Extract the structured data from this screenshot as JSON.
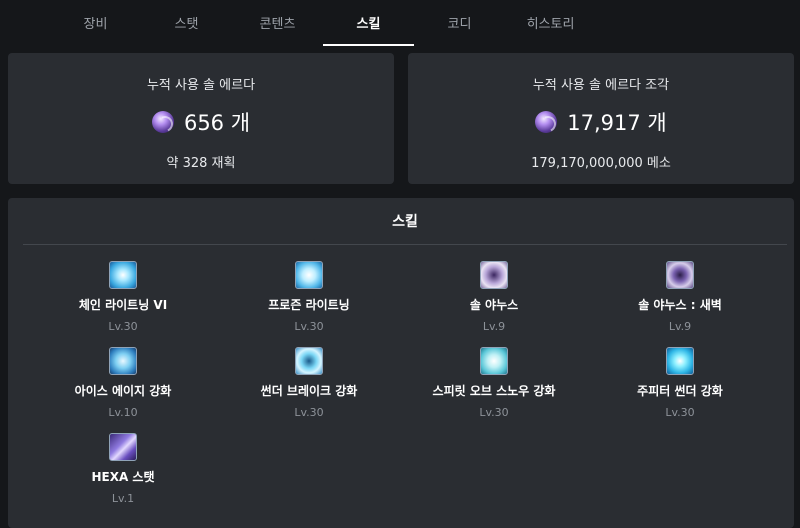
{
  "tabs": [
    {
      "label": "장비",
      "active": false
    },
    {
      "label": "스탯",
      "active": false
    },
    {
      "label": "콘텐츠",
      "active": false
    },
    {
      "label": "스킬",
      "active": true
    },
    {
      "label": "코디",
      "active": false
    },
    {
      "label": "히스토리",
      "active": false
    }
  ],
  "sol_erda": {
    "title": "누적 사용 솔 에르다",
    "value": "656 개",
    "sub": "약 328 재획",
    "icon": "sol-erda-orb-icon"
  },
  "sol_erda_fragment": {
    "title": "누적 사용 솔 에르다 조각",
    "value": "17,917 개",
    "sub": "179,170,000,000 메소",
    "icon": "sol-erda-orb-icon"
  },
  "skills": {
    "title": "스킬",
    "items": [
      {
        "name": "체인 라이트닝 VI",
        "level": "Lv.30",
        "icon": "chain-lightning-icon"
      },
      {
        "name": "프로즌 라이트닝",
        "level": "Lv.30",
        "icon": "frozen-lightning-icon"
      },
      {
        "name": "솔 야누스",
        "level": "Lv.9",
        "icon": "sol-janus-icon"
      },
      {
        "name": "솔 야누스 : 새벽",
        "level": "Lv.9",
        "icon": "sol-janus-dawn-icon"
      },
      {
        "name": "아이스 에이지 강화",
        "level": "Lv.10",
        "icon": "ice-age-icon"
      },
      {
        "name": "썬더 브레이크 강화",
        "level": "Lv.30",
        "icon": "thunder-break-icon"
      },
      {
        "name": "스피릿 오브 스노우 강화",
        "level": "Lv.30",
        "icon": "spirit-of-snow-icon"
      },
      {
        "name": "주피터 썬더 강화",
        "level": "Lv.30",
        "icon": "jupiter-thunder-icon"
      },
      {
        "name": "HEXA 스탯",
        "level": "Lv.1",
        "icon": "hexa-stat-icon"
      }
    ]
  }
}
